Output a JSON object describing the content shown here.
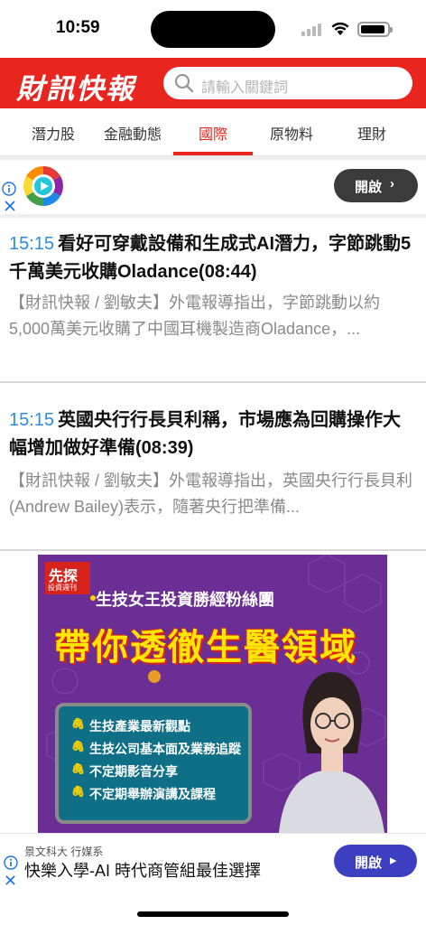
{
  "status_bar": {
    "time": "10:59"
  },
  "header": {
    "logo": "財訊快報",
    "search_placeholder": "請輸入關鍵詞"
  },
  "tabs": [
    {
      "label": "潛力股",
      "active": false
    },
    {
      "label": "金融動態",
      "active": false
    },
    {
      "label": "國際",
      "active": true
    },
    {
      "label": "原物料",
      "active": false
    },
    {
      "label": "理財",
      "active": false
    }
  ],
  "ad_top": {
    "button_label": "開啟"
  },
  "articles": [
    {
      "time": "15:15",
      "title": "看好可穿戴設備和生成式AI潛力，字節跳動5千萬美元收購Oladance(08:44)",
      "summary": "【財訊快報 / 劉敏夫】外電報導指出，字節跳動以約5,000萬美元收購了中國耳機製造商Oladance，..."
    },
    {
      "time": "15:15",
      "title": "英國央行行長貝利稱，市場應為回購操作大幅增加做好準備(08:39)",
      "summary": "【財訊快報 / 劉敏夫】外電報導指出，英國央行行長貝利(Andrew Bailey)表示，隨著央行把準備..."
    }
  ],
  "promo": {
    "badge_main": "先探",
    "badge_sub": "投資週刊",
    "subtitle": "生技女王投資勝經粉絲團",
    "title": "帶你透徹生醫領域",
    "bullets": [
      "生技產業最新觀點",
      "生技公司基本面及業務追蹤",
      "不定期影音分享",
      "不定期舉辦演講及課程"
    ]
  },
  "ad_bottom": {
    "brand": "景文科大 行媒系",
    "headline": "快樂入學-AI 時代商管組最佳選擇",
    "button_label": "開啟"
  },
  "colors": {
    "brand_red": "#e8251e",
    "time_blue": "#2a8fe0",
    "ad_button_dark": "#3b3b3b",
    "ad_button_blue": "#3b3fc0"
  }
}
